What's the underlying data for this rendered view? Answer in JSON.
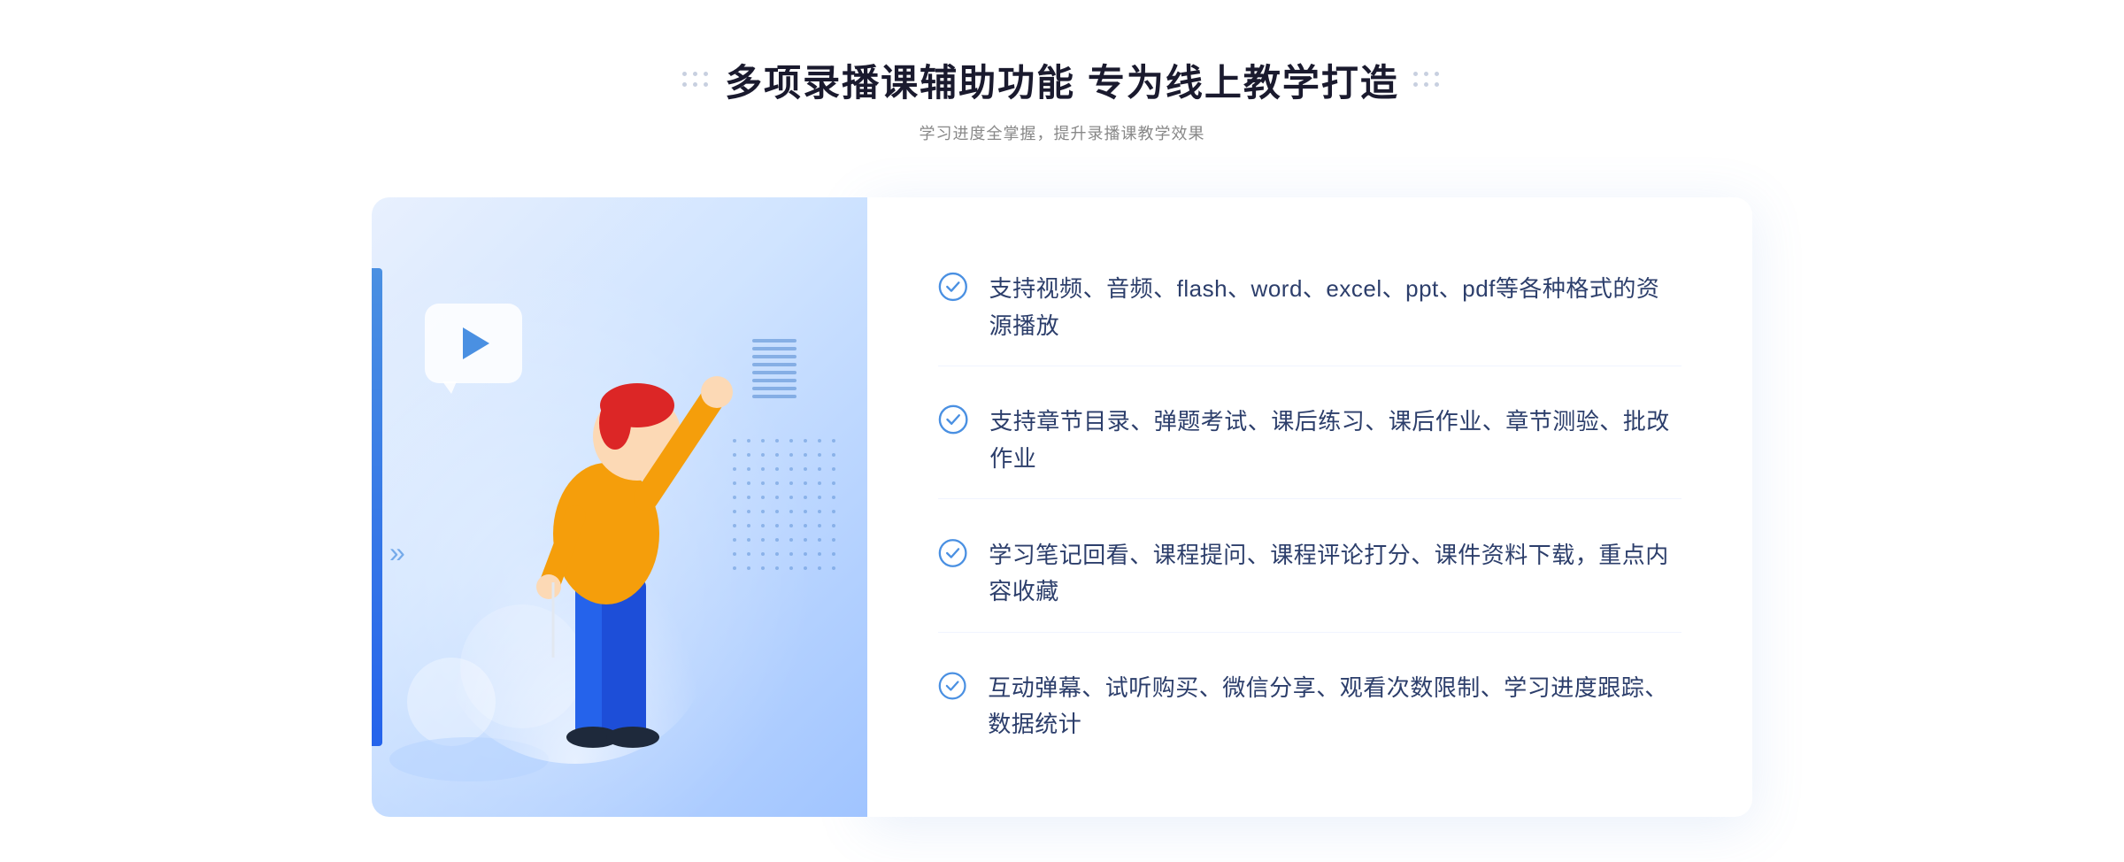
{
  "header": {
    "title": "多项录播课辅助功能 专为线上教学打造",
    "subtitle": "学习进度全掌握，提升录播课教学效果"
  },
  "features": [
    {
      "id": "feature-1",
      "text": "支持视频、音频、flash、word、excel、ppt、pdf等各种格式的资源播放"
    },
    {
      "id": "feature-2",
      "text": "支持章节目录、弹题考试、课后练习、课后作业、章节测验、批改作业"
    },
    {
      "id": "feature-3",
      "text": "学习笔记回看、课程提问、课程评论打分、课件资料下载，重点内容收藏"
    },
    {
      "id": "feature-4",
      "text": "互动弹幕、试听购买、微信分享、观看次数限制、学习进度跟踪、数据统计"
    }
  ],
  "decorative": {
    "dots_left": ":::",
    "dots_right": ":::",
    "check_color": "#4a90e2",
    "accent_color": "#2563eb",
    "bg_gradient_start": "#e8f0fe",
    "bg_gradient_end": "#a0c4ff"
  }
}
